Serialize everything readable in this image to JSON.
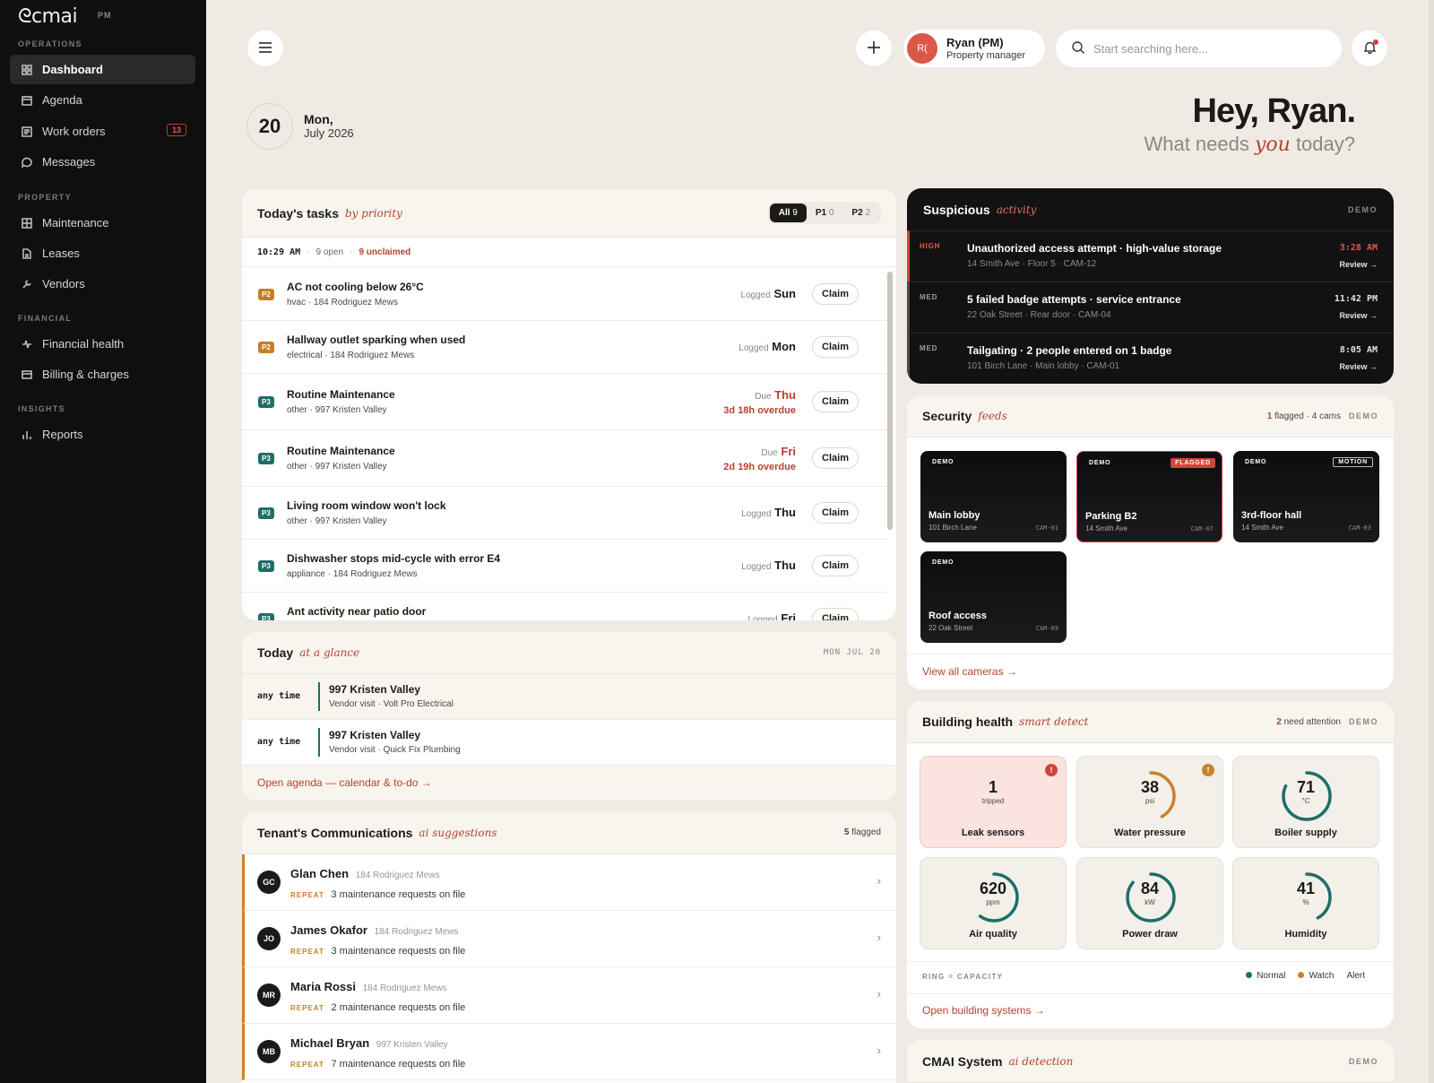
{
  "sidebar": {
    "logo": "ᘓcmai",
    "logo_suffix": "PM",
    "sections": {
      "operations": "OPERATIONS",
      "property": "PROPERTY",
      "financial": "FINANCIAL",
      "insights": "INSIGHTS"
    },
    "items": [
      {
        "label": "Dashboard",
        "icon": "grid-icon"
      },
      {
        "label": "Agenda",
        "icon": "calendar-icon"
      },
      {
        "label": "Work orders",
        "icon": "list-icon",
        "badge": "13"
      },
      {
        "label": "Messages",
        "icon": "chat-icon"
      },
      {
        "label": "Maintenance",
        "icon": "grid-icon"
      },
      {
        "label": "Leases",
        "icon": "document-icon"
      },
      {
        "label": "Vendors",
        "icon": "wrench-icon"
      },
      {
        "label": "Financial health",
        "icon": "pulse-icon"
      },
      {
        "label": "Billing & charges",
        "icon": "card-icon"
      },
      {
        "label": "Reports",
        "icon": "bar-chart-icon"
      }
    ]
  },
  "topbar": {
    "user_initials": "R(",
    "user_name": "Ryan (PM)",
    "user_role": "Property manager",
    "search_placeholder": "Start searching here..."
  },
  "date": {
    "day": "20",
    "weekday": "Mon,",
    "month_year": "July 2026"
  },
  "greeting": {
    "title": "Hey, Ryan.",
    "sub_before": "What needs ",
    "sub_em": "you",
    "sub_after": " today?"
  },
  "tasks": {
    "title": "Today's tasks",
    "subtitle": "by priority",
    "filters": [
      {
        "label": "All",
        "count": "9"
      },
      {
        "label": "P1",
        "count": "0"
      },
      {
        "label": "P2",
        "count": "2"
      }
    ],
    "time": "10:29 AM",
    "open": "9 open",
    "unclaimed": "9 unclaimed",
    "claim_label": "Claim",
    "rows": [
      {
        "priority": "P2",
        "title": "AC not cooling below 26°C",
        "meta": "hvac · 184 Rodriguez Mews",
        "when_label": "Logged",
        "when_day": "Sun",
        "overdue": ""
      },
      {
        "priority": "P2",
        "title": "Hallway outlet sparking when used",
        "meta": "electrical · 184 Rodriguez Mews",
        "when_label": "Logged",
        "when_day": "Mon",
        "overdue": ""
      },
      {
        "priority": "P3",
        "title": "Routine Maintenance",
        "meta": "other · 997 Kristen Valley",
        "when_label": "Due",
        "when_day": "Thu",
        "overdue": "3d 18h overdue"
      },
      {
        "priority": "P3",
        "title": "Routine Maintenance",
        "meta": "other · 997 Kristen Valley",
        "when_label": "Due",
        "when_day": "Fri",
        "overdue": "2d 19h overdue"
      },
      {
        "priority": "P3",
        "title": "Living room window won't lock",
        "meta": "other · 997 Kristen Valley",
        "when_label": "Logged",
        "when_day": "Thu",
        "overdue": ""
      },
      {
        "priority": "P3",
        "title": "Dishwasher stops mid-cycle with error E4",
        "meta": "appliance · 184 Rodriguez Mews",
        "when_label": "Logged",
        "when_day": "Thu",
        "overdue": ""
      },
      {
        "priority": "P3",
        "title": "Ant activity near patio door",
        "meta": "",
        "when_label": "Logged",
        "when_day": "Fri",
        "overdue": ""
      }
    ]
  },
  "glance": {
    "title": "Today",
    "subtitle": "at a glance",
    "date": "MON JUL 20",
    "rows": [
      {
        "time": "any time",
        "place": "997 Kristen Valley",
        "detail": "Vendor visit · Volt Pro Electrical"
      },
      {
        "time": "any time",
        "place": "997 Kristen Valley",
        "detail": "Vendor visit · Quick Fix Plumbing"
      }
    ],
    "link": "Open agenda — calendar & to-do →"
  },
  "comms": {
    "title": "Tenant's Communications",
    "subtitle": "ai suggestions",
    "flagged_count": "5",
    "flagged_label": " flagged",
    "rows": [
      {
        "initials": "GC",
        "name": "Glan Chen",
        "address": "184 Rodriguez Mews",
        "tag": "REPEAT",
        "note": "3 maintenance requests on file"
      },
      {
        "initials": "JO",
        "name": "James Okafor",
        "address": "184 Rodriguez Mews",
        "tag": "REPEAT",
        "note": "3 maintenance requests on file"
      },
      {
        "initials": "MR",
        "name": "Maria Rossi",
        "address": "184 Rodriguez Mews",
        "tag": "REPEAT",
        "note": "2 maintenance requests on file"
      },
      {
        "initials": "MB",
        "name": "Michael Bryan",
        "address": "997 Kristen Valley",
        "tag": "REPEAT",
        "note": "7 maintenance requests on file"
      }
    ]
  },
  "suspicious": {
    "title": "Suspicious",
    "subtitle": "activity",
    "demo": "DEMO",
    "review": "Review →",
    "rows": [
      {
        "level": "HIGH",
        "title": "Unauthorized access attempt · high-value storage",
        "meta": "14 Smith Ave · Floor 5 · CAM-12",
        "time": "3:28 AM"
      },
      {
        "level": "MED",
        "title": "5 failed badge attempts · service entrance",
        "meta": "22 Oak Street · Rear door · CAM-04",
        "time": "11:42 PM"
      },
      {
        "level": "MED",
        "title": "Tailgating · 2 people entered on 1 badge",
        "meta": "101 Birch Lane · Main lobby · CAM-01",
        "time": "8:05 AM"
      }
    ]
  },
  "security": {
    "title": "Security",
    "subtitle": "feeds",
    "flagged_count": "1",
    "flagged_rest": " flagged · 4 cams",
    "demo": "DEMO",
    "cams": [
      {
        "demo": "DEMO",
        "tag": "",
        "name": "Main lobby",
        "addr": "101 Birch Lane",
        "id": "CAM-01"
      },
      {
        "demo": "DEMO",
        "tag": "FLAGGED",
        "name": "Parking B2",
        "addr": "14 Smith Ave",
        "id": "CAM-07"
      },
      {
        "demo": "DEMO",
        "tag": "MOTION",
        "name": "3rd-floor hall",
        "addr": "14 Smith Ave",
        "id": "CAM-03"
      },
      {
        "demo": "DEMO",
        "tag": "",
        "name": "Roof access",
        "addr": "22 Oak Street",
        "id": "CAM-09"
      }
    ],
    "link": "View all cameras →"
  },
  "health": {
    "title": "Building health",
    "subtitle": "smart detect",
    "attention_count": "2",
    "attention_rest": " need attention",
    "demo": "DEMO",
    "metrics": [
      {
        "value": "1",
        "unit": "tripped",
        "label": "Leak sensors",
        "status": "alert",
        "level": null
      },
      {
        "value": "38",
        "unit": "psi",
        "label": "Water pressure",
        "status": "watch",
        "level": 0.42
      },
      {
        "value": "71",
        "unit": "°C",
        "label": "Boiler supply",
        "status": "normal",
        "level": 0.82
      },
      {
        "value": "620",
        "unit": "ppm",
        "label": "Air quality",
        "status": "normal",
        "level": 0.6
      },
      {
        "value": "84",
        "unit": "kW",
        "label": "Power draw",
        "status": "normal",
        "level": 0.86
      },
      {
        "value": "41",
        "unit": "%",
        "label": "Humidity",
        "status": "normal",
        "level": 0.42
      }
    ],
    "legend_caption": "RING = CAPACITY",
    "legend": {
      "normal": "Normal",
      "watch": "Watch",
      "alert": "Alert"
    },
    "link": "Open building systems →"
  },
  "cmai": {
    "title": "CMAI System",
    "subtitle": "ai detection",
    "demo": "DEMO"
  },
  "colors": {
    "accent": "#b5422e",
    "normal": "#1f6e68",
    "watch": "#c8822a",
    "alert": "#d2433a",
    "p2": "#c77e22",
    "p3": "#1f6e68"
  }
}
